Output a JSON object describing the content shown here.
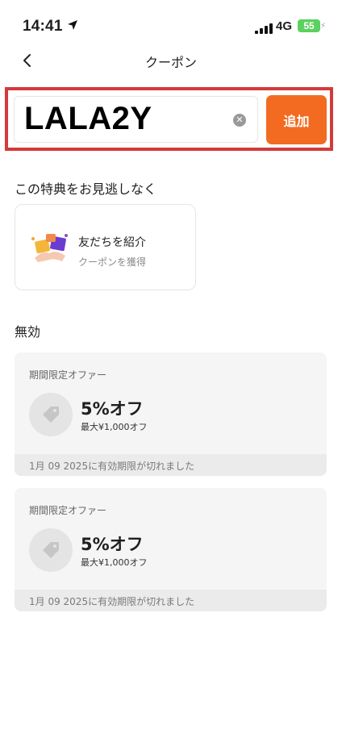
{
  "status": {
    "time": "14:41",
    "network": "4G",
    "battery": "55"
  },
  "nav": {
    "title": "クーポン"
  },
  "code_input": {
    "value": "LALA2Y"
  },
  "add_button": "追加",
  "promo_section": {
    "title": "この特典をお見逃しなく",
    "card_title": "友だちを紹介",
    "card_subtitle": "クーポンを獲得"
  },
  "invalid_section": {
    "title": "無効"
  },
  "coupons": [
    {
      "label": "期間限定オファー",
      "discount": "5%オフ",
      "max": "最大¥1,000オフ",
      "expired": "1月 09 2025に有効期限が切れました"
    },
    {
      "label": "期間限定オファー",
      "discount": "5%オフ",
      "max": "最大¥1,000オフ",
      "expired": "1月 09 2025に有効期限が切れました"
    }
  ],
  "colors": {
    "accent": "#f26b21",
    "highlight": "#d43a3a",
    "card_bg": "#f5f5f5"
  }
}
